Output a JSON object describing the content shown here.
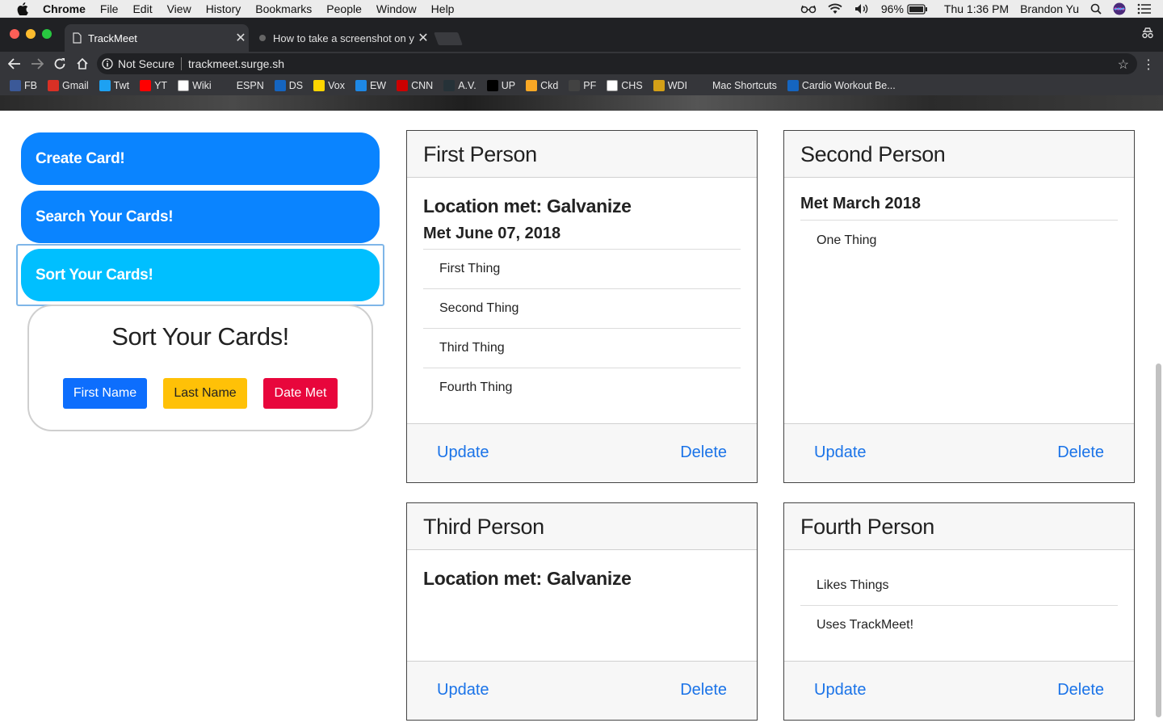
{
  "menubar": {
    "app": "Chrome",
    "items": [
      "File",
      "Edit",
      "View",
      "History",
      "Bookmarks",
      "People",
      "Window",
      "Help"
    ],
    "battery": "96%",
    "clock": "Thu 1:36 PM",
    "user": "Brandon Yu"
  },
  "tabs": {
    "active_title": "TrackMeet",
    "inactive_title": "How to take a screenshot on y"
  },
  "toolbar": {
    "security_label": "Not Secure",
    "url": "trackmeet.surge.sh"
  },
  "bookmarks": [
    {
      "label": "FB",
      "icon": "facebook-icon",
      "color": "#3b5998"
    },
    {
      "label": "Gmail",
      "icon": "gmail-icon",
      "color": "#d93025"
    },
    {
      "label": "Twt",
      "icon": "twitter-icon",
      "color": "#1da1f2"
    },
    {
      "label": "YT",
      "icon": "youtube-icon",
      "color": "#ff0000"
    },
    {
      "label": "Wiki",
      "icon": "wikipedia-icon",
      "color": "#ffffff"
    },
    {
      "label": "ESPN",
      "icon": "page-icon",
      "color": "#35363a"
    },
    {
      "label": "DS",
      "icon": "ds-icon",
      "color": "#1565c0"
    },
    {
      "label": "Vox",
      "icon": "vox-icon",
      "color": "#ffd600"
    },
    {
      "label": "EW",
      "icon": "ew-icon",
      "color": "#1e88e5"
    },
    {
      "label": "CNN",
      "icon": "cnn-icon",
      "color": "#cc0000"
    },
    {
      "label": "A.V.",
      "icon": "av-icon",
      "color": "#263238"
    },
    {
      "label": "UP",
      "icon": "up-icon",
      "color": "#000000"
    },
    {
      "label": "Ckd",
      "icon": "ckd-icon",
      "color": "#f9a825"
    },
    {
      "label": "PF",
      "icon": "pf-icon",
      "color": "#424242"
    },
    {
      "label": "CHS",
      "icon": "chs-icon",
      "color": "#ffffff"
    },
    {
      "label": "WDI",
      "icon": "wdi-icon",
      "color": "#d4a017"
    },
    {
      "label": "Mac Shortcuts",
      "icon": "apple-icon",
      "color": "#35363a"
    },
    {
      "label": "Cardio Workout Be...",
      "icon": "ps-icon",
      "color": "#1565c0"
    }
  ],
  "sidebar": {
    "create_label": "Create Card!",
    "search_label": "Search Your Cards!",
    "sort_label": "Sort Your Cards!",
    "sort_panel": {
      "title": "Sort Your Cards!",
      "first_name": "First Name",
      "last_name": "Last Name",
      "date_met": "Date Met"
    }
  },
  "cards": [
    {
      "name": "First Person",
      "location": "Location met: Galvanize",
      "met": "Met June 07, 2018",
      "items": [
        "First Thing",
        "Second Thing",
        "Third Thing",
        "Fourth Thing"
      ],
      "update": "Update",
      "delete": "Delete"
    },
    {
      "name": "Second Person",
      "met": "Met March 2018",
      "items": [
        "One Thing"
      ],
      "update": "Update",
      "delete": "Delete"
    },
    {
      "name": "Third Person",
      "location": "Location met: Galvanize",
      "update": "Update",
      "delete": "Delete"
    },
    {
      "name": "Fourth Person",
      "items": [
        "Likes Things",
        "Uses TrackMeet!"
      ],
      "update": "Update",
      "delete": "Delete"
    }
  ],
  "colors": {
    "primary": "#0a84ff",
    "info": "#00bfff",
    "warning": "#ffc107",
    "danger": "#e8063c",
    "link": "#1a73e8"
  }
}
